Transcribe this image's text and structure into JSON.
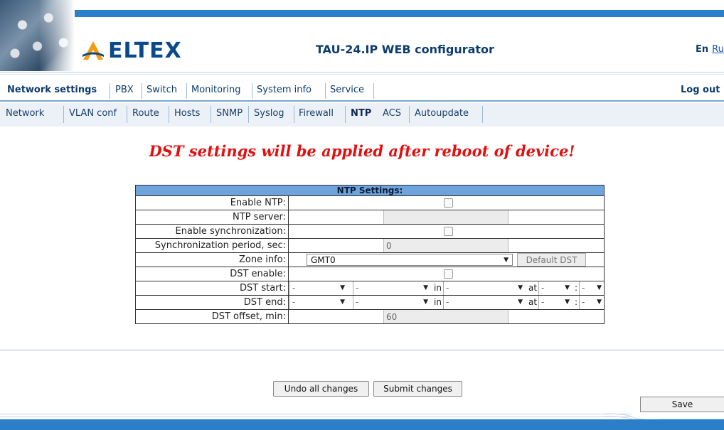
{
  "header": {
    "brand": "ELTEX",
    "app_title": "TAU-24.IP WEB configurator",
    "lang_en": "En",
    "lang_ru": "Ru",
    "accent_color": "#2a7fc8"
  },
  "nav_primary": {
    "items": [
      {
        "label": "Network settings",
        "active": true
      },
      {
        "label": "PBX"
      },
      {
        "label": "Switch"
      },
      {
        "label": "Monitoring"
      },
      {
        "label": "System info"
      },
      {
        "label": "Service"
      }
    ],
    "logout_label": "Log out"
  },
  "nav_secondary": {
    "items": [
      {
        "label": "Network"
      },
      {
        "label": "VLAN conf"
      },
      {
        "label": "Route"
      },
      {
        "label": "Hosts"
      },
      {
        "label": "SNMP"
      },
      {
        "label": "Syslog"
      },
      {
        "label": "Firewall"
      },
      {
        "label": "NTP",
        "active": true
      },
      {
        "label": "ACS"
      },
      {
        "label": "Autoupdate"
      }
    ]
  },
  "warning": "DST settings will be applied after reboot of device!",
  "ntp": {
    "title": "NTP Settings:",
    "enable_ntp": {
      "label": "Enable NTP:",
      "checked": false
    },
    "ntp_server": {
      "label": "NTP server:",
      "value": ""
    },
    "enable_sync": {
      "label": "Enable synchronization:",
      "checked": false
    },
    "sync_period": {
      "label": "Synchronization period, sec:",
      "value": "0"
    },
    "zone_info": {
      "label": "Zone info:",
      "value": "GMT0",
      "default_dst_label": "Default DST"
    },
    "dst_enable": {
      "label": "DST enable:",
      "checked": false
    },
    "dst_start": {
      "label": "DST start:",
      "month": "-",
      "week": "-",
      "in_label": "in",
      "day": "-",
      "at_label": "at",
      "hour": "-",
      "colon": ":",
      "minute": "-"
    },
    "dst_end": {
      "label": "DST end:",
      "month": "-",
      "week": "-",
      "in_label": "in",
      "day": "-",
      "at_label": "at",
      "hour": "-",
      "colon": ":",
      "minute": "-"
    },
    "dst_offset": {
      "label": "DST offset, min:",
      "value": "60"
    }
  },
  "actions": {
    "undo_label": "Undo all changes",
    "submit_label": "Submit changes",
    "save_label": "Save"
  }
}
